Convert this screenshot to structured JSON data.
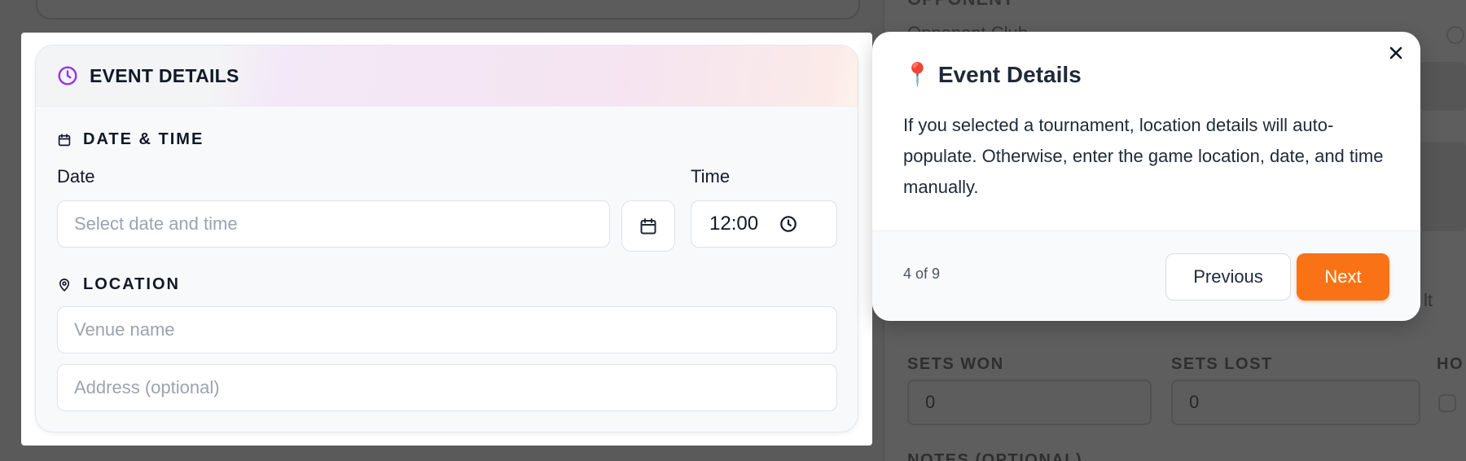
{
  "background": {
    "opponent_header": "OPPONENT",
    "opponent_field_partial": "Opponent Club",
    "result_partial": "lt",
    "sets_won_label": "SETS WON",
    "sets_won_value": "0",
    "sets_lost_label": "SETS LOST",
    "sets_lost_value": "0",
    "home_label_partial": "HO",
    "notes_header_partial": "NOTES (OPTIONAL)"
  },
  "panel": {
    "title": "EVENT DETAILS",
    "date_time_section": "DATE & TIME",
    "date_label": "Date",
    "date_placeholder": "Select date and time",
    "time_label": "Time",
    "time_value": "12:00",
    "location_section": "LOCATION",
    "venue_placeholder": "Venue name",
    "address_placeholder": "Address (optional)"
  },
  "tour": {
    "title_emoji": "📍",
    "title": "Event Details",
    "body": "If you selected a tournament, location details will auto-populate. Otherwise, enter the game location, date, and time manually.",
    "progress": "4 of 9",
    "prev_label": "Previous",
    "next_label": "Next",
    "accent_color": "#f97316"
  },
  "colors": {
    "clock_icon": "#9333ea"
  }
}
